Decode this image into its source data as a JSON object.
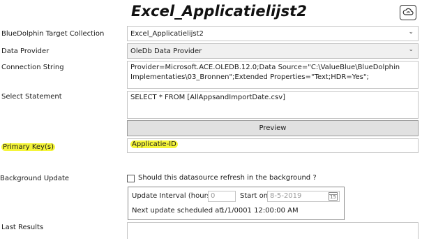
{
  "title": "Excel_Applicatielijst2",
  "icons": {
    "cloud_sync": "cloud-sync-icon"
  },
  "fields": {
    "target_collection": {
      "label": "BlueDolphin Target Collection",
      "value": "Excel_Applicatielijst2"
    },
    "data_provider": {
      "label": "Data Provider",
      "value": "OleDb Data Provider"
    },
    "connection_string": {
      "label": "Connection String",
      "value": "Provider=Microsoft.ACE.OLEDB.12.0;Data Source=\"C:\\ValueBlue\\BlueDolphin Implementaties\\03_Bronnen\";Extended Properties=\"Text;HDR=Yes\";"
    },
    "select_statement": {
      "label": "Select Statement",
      "value": "SELECT * FROM [AllAppsandImportDate.csv]"
    },
    "preview_button": "Preview",
    "primary_keys": {
      "label": "Primary Key(s)",
      "value": "Applicatie-ID"
    },
    "background_update": {
      "label": "Background Update",
      "checkbox_label": "Should this datasource refresh in the background ?",
      "checked": false,
      "interval_label": "Update Interval (hours)",
      "interval_value": "0",
      "start_on_label": "Start on",
      "start_on_value": "8-5-2019",
      "calendar_day": "15",
      "next_update_label": "Next update scheduled at:",
      "next_update_value": "1/1/0001 12:00:00 AM"
    },
    "last_results": {
      "label": "Last Results"
    }
  },
  "colors": {
    "highlight": "#f5f53a",
    "button_bg": "#e1e1e1",
    "dropdown_bg": "#f0f0f0"
  }
}
